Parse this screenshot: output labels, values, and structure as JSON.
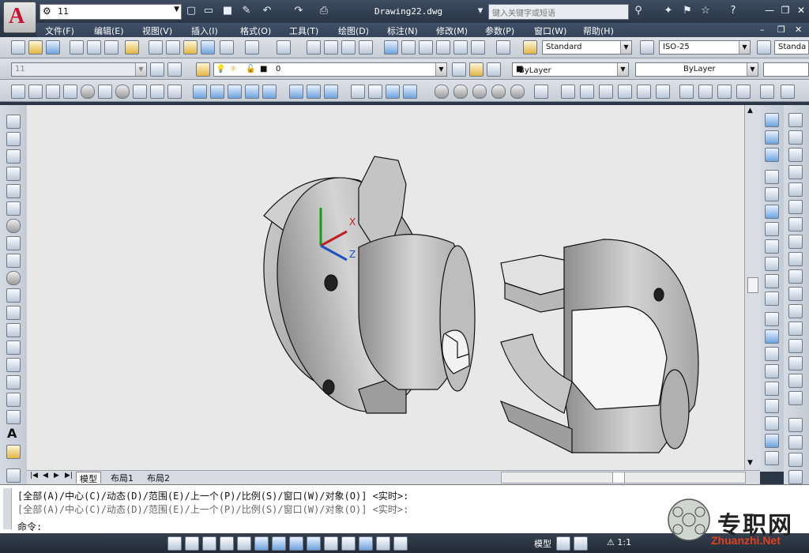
{
  "app": {
    "document_title": "Drawing22.dwg",
    "workspace_value": "11",
    "search_placeholder": "键入关键字或短语"
  },
  "menu": [
    "文件(F)",
    "编辑(E)",
    "视图(V)",
    "插入(I)",
    "格式(O)",
    "工具(T)",
    "绘图(D)",
    "标注(N)",
    "修改(M)",
    "参数(P)",
    "窗口(W)",
    "帮助(H)"
  ],
  "styles": {
    "text_style": "Standard",
    "dim_style": "ISO-25",
    "table_style": "Standa"
  },
  "layers": {
    "layer_combo_left": "11",
    "current_layer": "0",
    "color": "ByLayer",
    "linetype": "ByLayer"
  },
  "tabs": [
    "模型",
    "布局1",
    "布局2"
  ],
  "command": {
    "history_1": "[全部(A)/中心(C)/动态(D)/范围(E)/上一个(P)/比例(S)/窗口(W)/对象(O)] <实时>:",
    "history_2": "[全部(A)/中心(C)/动态(D)/范围(E)/上一个(P)/比例(S)/窗口(W)/对象(O)] <实时>:",
    "prompt": "命令:"
  },
  "status": {
    "model_label": "模型",
    "scale": "1:1"
  },
  "watermark": {
    "text": "专职网",
    "url": "Zhuanzhi.Net"
  },
  "ucs": {
    "x": "X",
    "z": "Z"
  },
  "colors": {
    "title_bg": "#2f3b4c",
    "canvas_bg": "#e8e8e8",
    "accent_red": "#c8102e"
  }
}
